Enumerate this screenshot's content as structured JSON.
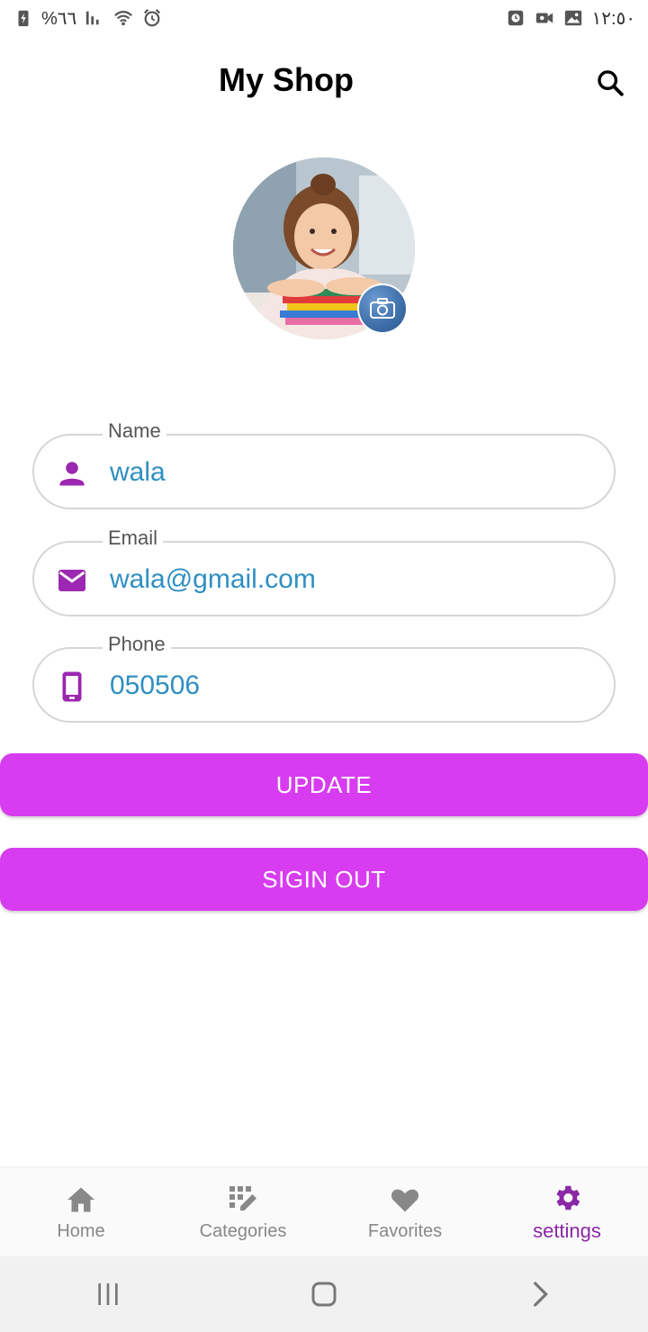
{
  "status_bar": {
    "battery": "%٦٦",
    "time": "١٢:٥٠"
  },
  "app_bar": {
    "title": "My Shop",
    "search_icon": "search-icon"
  },
  "profile": {
    "avatar_alt": "",
    "camera_icon": "camera-icon"
  },
  "form": {
    "name": {
      "label": "Name",
      "value": "wala",
      "icon": "person-icon"
    },
    "email": {
      "label": "Email",
      "value": "wala@gmail.com",
      "icon": "mail-icon"
    },
    "phone": {
      "label": "Phone",
      "value": "050506",
      "icon": "phone-icon"
    }
  },
  "buttons": {
    "update": "UPDATE",
    "signout": "SIGIN OUT"
  },
  "bottom_nav": {
    "items": [
      {
        "label": "Home",
        "icon": "home-icon",
        "active": false
      },
      {
        "label": "Categories",
        "icon": "categories-icon",
        "active": false
      },
      {
        "label": "Favorites",
        "icon": "heart-icon",
        "active": false
      },
      {
        "label": "settings",
        "icon": "gear-icon",
        "active": true
      }
    ]
  },
  "colors": {
    "accent": "#d83cf0",
    "icon_purple": "#9c27b0",
    "value_blue": "#2f8fc2",
    "active_nav": "#8b28a6"
  }
}
